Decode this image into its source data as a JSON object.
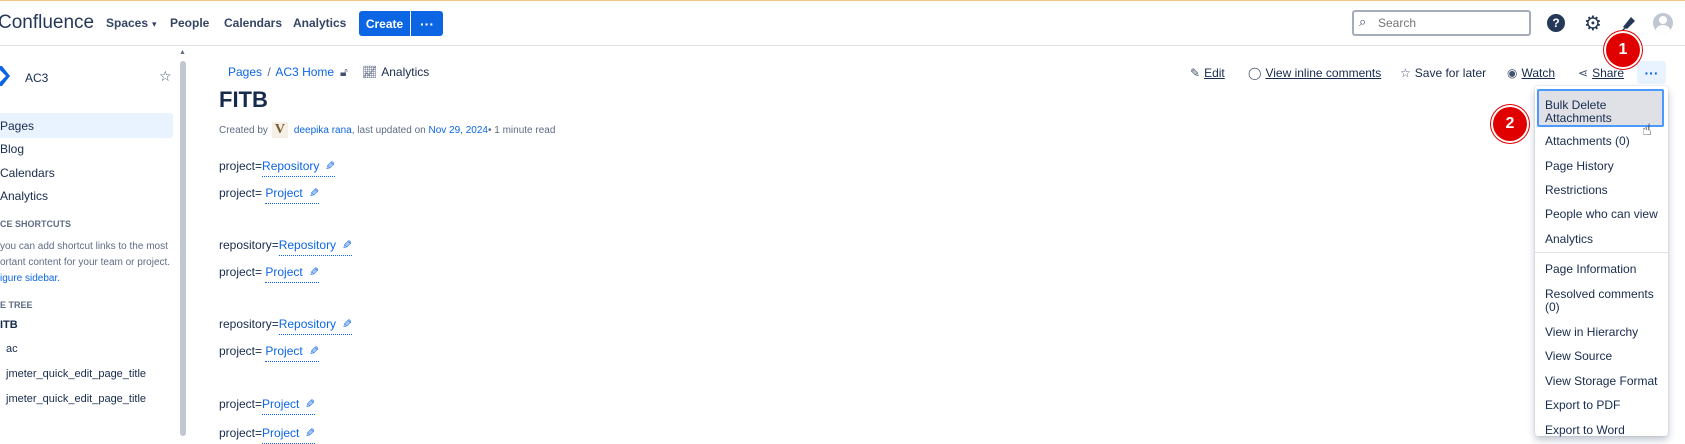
{
  "header": {
    "logo": "Confluence",
    "nav": [
      {
        "label": "Spaces",
        "has_menu": true
      },
      {
        "label": "People"
      },
      {
        "label": "Calendars"
      },
      {
        "label": "Analytics"
      }
    ],
    "create_label": "Create",
    "create_more_label": "···",
    "search_placeholder": "Search"
  },
  "sidebar": {
    "space_name": "AC3",
    "items": [
      "Pages",
      "Blog",
      "Calendars",
      "Analytics"
    ],
    "shortcuts_heading": "CE SHORTCUTS",
    "shortcuts_text_1": "you can add shortcut links to the most",
    "shortcuts_text_2": "ortant content for your team or project.",
    "shortcuts_link": "igure sidebar.",
    "tree_heading": "E TREE",
    "tree": [
      "ITB",
      "ac",
      "jmeter_quick_edit_page_title",
      "jmeter_quick_edit_page_title"
    ]
  },
  "breadcrumb": {
    "pages": "Pages",
    "sep": "/",
    "home": "AC3 Home",
    "analytics": "Analytics"
  },
  "page": {
    "title": "FITB",
    "created_by": "Created by",
    "author": "deepika rana",
    "updated_text": ", last updated on",
    "date": "Nov 29, 2024",
    "read_time": " • 1 minute read",
    "lines": [
      {
        "prefix": "project=",
        "link": "Repository"
      },
      {
        "prefix": "project= ",
        "link": "Project"
      },
      {
        "prefix": "repository=",
        "link": "Repository"
      },
      {
        "prefix": "project= ",
        "link": "Project"
      },
      {
        "prefix": "repository=",
        "link": "Repository"
      },
      {
        "prefix": "project= ",
        "link": "Project"
      },
      {
        "prefix": "project=",
        "link": "Project"
      },
      {
        "prefix": "project=",
        "link": "Project"
      }
    ]
  },
  "actions": {
    "edit": "Edit",
    "inline_comments": "View inline comments",
    "save_later": "Save for later",
    "watch": "Watch",
    "share": "Share",
    "more": "···"
  },
  "menu": {
    "items": [
      "Bulk Delete Attachments",
      "Attachments (0)",
      "Page History",
      "Restrictions",
      "People who can view",
      "Analytics",
      "Page Information",
      "Resolved comments (0)",
      "View in Hierarchy",
      "View Source",
      "View Storage Format",
      "Export to PDF",
      "Export to Word"
    ]
  },
  "annotations": {
    "step1": "1",
    "step2": "2"
  },
  "colors": {
    "accent": "#0c66e4",
    "badge": "#e00000"
  }
}
